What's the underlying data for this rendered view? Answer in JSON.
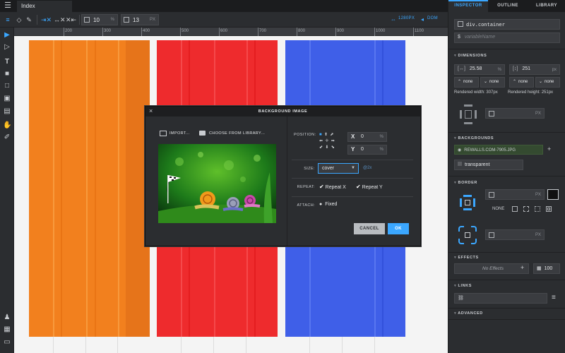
{
  "window": {
    "tab_label": "Index"
  },
  "toolbar": {
    "width_value": "10",
    "width_unit": "%",
    "height_value": "13",
    "height_unit": "PX",
    "breakpoint_label": "1280PX",
    "dom_label": "DOM"
  },
  "ruler": {
    "ticks": [
      "200",
      "300",
      "400",
      "500",
      "600",
      "700",
      "800",
      "900",
      "1000",
      "1100"
    ]
  },
  "panel": {
    "tabs": [
      "INSPECTOR",
      "OUTLINE",
      "LIBRARY"
    ],
    "active_tab": "INSPECTOR",
    "selector": "div.container",
    "variable_placeholder": "variableName",
    "dimensions": {
      "title": "DIMENSIONS",
      "width_value": "25.58",
      "width_unit": "%",
      "height_value": "251",
      "height_unit": "px",
      "min_width": "none",
      "max_width": "none",
      "min_height": "none",
      "max_height": "none",
      "rendered_width": "Rendered width: 307px",
      "rendered_height": "Rendered height: 251px",
      "padding_unit": "PX"
    },
    "backgrounds": {
      "title": "BACKGROUNDS",
      "image_name": "REWALLS.COM-7905.JPG",
      "color_label": "transparent"
    },
    "border": {
      "title": "BORDER",
      "unit": "PX",
      "style": "NONE",
      "radius_unit": "PX"
    },
    "effects": {
      "title": "EFFECTS",
      "placeholder": "No Effects",
      "opacity": "100"
    },
    "links": {
      "title": "LINKS"
    },
    "advanced": {
      "title": "ADVANCED"
    }
  },
  "modal": {
    "title": "BACKGROUND IMAGE",
    "import_label": "IMPORT...",
    "library_label": "CHOOSE FROM LIBRARY...",
    "position_label": "POSITION:",
    "x_label": "X",
    "x_value": "0",
    "x_unit": "%",
    "y_label": "Y",
    "y_value": "0",
    "y_unit": "%",
    "size_label": "SIZE:",
    "size_value": "cover",
    "retina_label": "@2x",
    "repeat_label": "REPEAT:",
    "repeat_x": "Repeat X",
    "repeat_y": "Repeat Y",
    "attach_label": "ATTACH:",
    "attach_value": "Fixed",
    "cancel_label": "CANCEL",
    "ok_label": "OK"
  },
  "colors": {
    "accent": "#3ba7ff",
    "orange": "#f2801e",
    "red": "#ee2b2d",
    "blue": "#3f5fe8"
  }
}
